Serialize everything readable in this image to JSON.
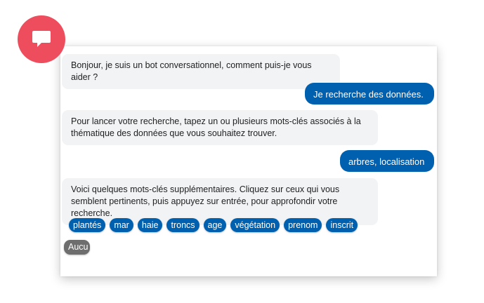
{
  "launcher": {
    "icon": "chat-bubble-icon",
    "color": "#ee4d5d"
  },
  "colors": {
    "accent": "#0060b0",
    "bot_bubble": "#f1f3f5",
    "muted_chip": "#6e6e6e"
  },
  "messages": [
    {
      "from": "bot",
      "text": "Bonjour, je suis un bot conversationnel, comment puis-je vous aider ?"
    },
    {
      "from": "user",
      "text": "Je recherche des données."
    },
    {
      "from": "bot",
      "text": "Pour lancer votre recherche, tapez un ou plusieurs mots-clés associés à la thématique des données que vous souhaitez trouver."
    },
    {
      "from": "user",
      "text": "arbres, localisation"
    },
    {
      "from": "bot",
      "text": "Voici quelques mots-clés supplémentaires. Cliquez sur ceux qui vous semblent pertinents, puis appuyez sur entrée, pour approfondir votre recherche."
    }
  ],
  "keywords": [
    "plantés",
    "mar",
    "haie",
    "troncs",
    "age",
    "végétation",
    "prenom",
    "inscrit"
  ],
  "none_option": "Aucu"
}
